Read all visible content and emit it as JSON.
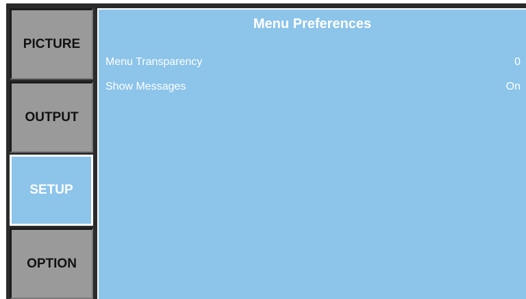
{
  "tabs": [
    {
      "label": "PICTURE"
    },
    {
      "label": "OUTPUT"
    },
    {
      "label": "SETUP"
    },
    {
      "label": "OPTION"
    }
  ],
  "active_tab": "SETUP",
  "panel": {
    "title": "Menu Preferences",
    "rows": [
      {
        "label": "Menu Transparency",
        "value": "0"
      },
      {
        "label": "Show Messages",
        "value": "On"
      }
    ]
  },
  "colors": {
    "panel_bg": "#8cc4ea",
    "tab_bg": "#9a9a9a",
    "frame": "#2b2b2b",
    "text_light": "#ffffff"
  }
}
